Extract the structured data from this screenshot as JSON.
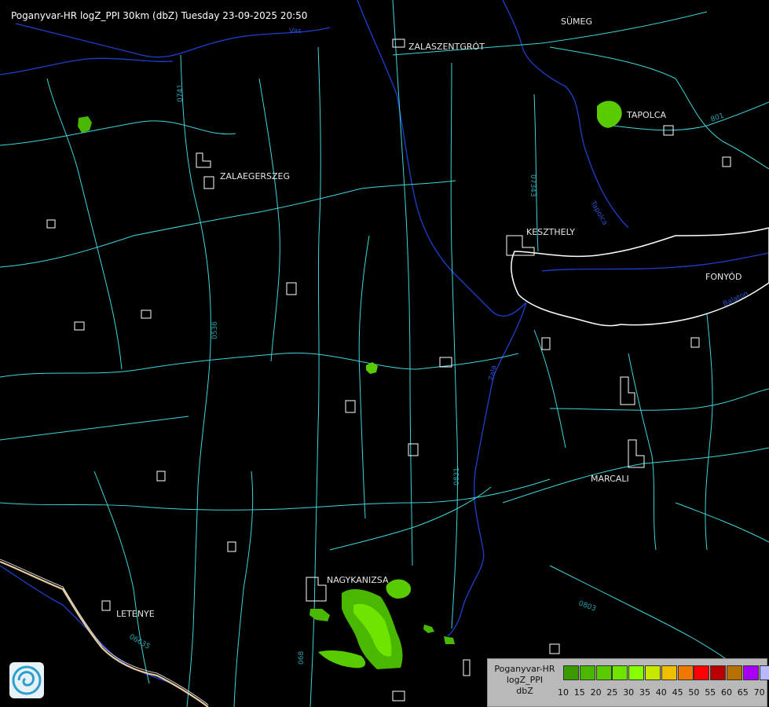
{
  "title": "Poganyvar-HR logZ_PPI 30km (dbZ) Tuesday 23-09-2025 20:50",
  "cities": {
    "sumeg": "SÜMEG",
    "zalaszentgrot": "ZALASZENTGRÓT",
    "tapolca": "TAPOLCA",
    "zalaegerszeg": "ZALAEGERSZEG",
    "keszthely": "KESZTHELY",
    "fonyod": "FONYÓD",
    "marcali": "MARCALI",
    "nagykanizsa": "NAGYKANIZSA",
    "letenye": "LETENYE"
  },
  "road_labels": {
    "r0741": "0741",
    "r07343": "07343",
    "r0536": "0536",
    "r0831": "0831",
    "r0803": "0803",
    "r06635": "06635",
    "r068": "068",
    "r801": "801"
  },
  "river_labels": {
    "vas": "Vas",
    "zala": "Zala",
    "tapolca": "Tapolca",
    "balaton": "Balaton"
  },
  "legend": {
    "line1": "Poganyvar-HR",
    "line2": "logZ_PPI",
    "line3": "dbZ",
    "bins": [
      {
        "value": "10",
        "color": "#3a9a00"
      },
      {
        "value": "15",
        "color": "#4ab800"
      },
      {
        "value": "20",
        "color": "#58cc00"
      },
      {
        "value": "25",
        "color": "#6ee400"
      },
      {
        "value": "30",
        "color": "#86ff00"
      },
      {
        "value": "35",
        "color": "#c8e800"
      },
      {
        "value": "40",
        "color": "#f0c000"
      },
      {
        "value": "45",
        "color": "#f07800"
      },
      {
        "value": "50",
        "color": "#ff0000"
      },
      {
        "value": "55",
        "color": "#b80000"
      },
      {
        "value": "60",
        "color": "#b87000"
      },
      {
        "value": "65",
        "color": "#a800f0"
      },
      {
        "value": "70",
        "color": "#b8b8ff"
      }
    ]
  },
  "colors": {
    "background": "#000000",
    "roads": "#3fd6dc",
    "rivers": "#1f3fd0",
    "borders": "#ffffff",
    "lake": "#ffffff"
  },
  "logo": {
    "icon": "hungarian-met-service-logo"
  }
}
